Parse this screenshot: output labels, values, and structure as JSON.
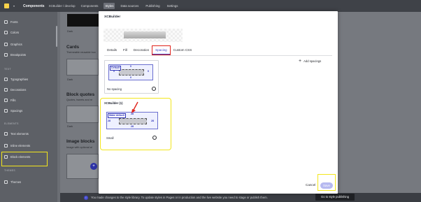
{
  "topbar": {
    "app_name": "Components",
    "app_sub": "XCBuilder / develop",
    "nav": [
      "Components",
      "Styles",
      "Data sources",
      "Publishing",
      "Settings"
    ],
    "active_nav": "Styles"
  },
  "sidebar": {
    "items_top": [
      "Fonts",
      "Colors",
      "Graphics",
      "Breakpoints"
    ],
    "section_text": "TEXT",
    "items_text": [
      "Typographies",
      "Decorations",
      "Fills",
      "Spacings"
    ],
    "section_elements": "ELEMENTS",
    "items_elements": [
      "Text elements",
      "Inline elements",
      "Block elements"
    ],
    "section_themes": "THEMES",
    "items_themes": [
      "Themes"
    ]
  },
  "background": {
    "dark_label_1": "Dark",
    "cards_title": "Cards",
    "cards_sub": "Themeable reusable box",
    "dark_label_2": "Dark",
    "quotes_title": "Block quotes",
    "quotes_sub": "Quotes, tweets and re",
    "dark_label_3": "Dark",
    "images_title": "Image blocks",
    "images_sub": "Image with optional al",
    "plus": "+"
  },
  "modal": {
    "title": "XCBuilder",
    "tabs": [
      "Details",
      "Fill",
      "Decoration",
      "Spacing",
      "Custom CSS"
    ],
    "active_tab": "Spacing",
    "add_spacing": "Add spacings",
    "card_a": {
      "tag": "Default",
      "numbers": [
        "0",
        "0",
        "0",
        "0"
      ],
      "label": "No spacing",
      "more": "..."
    },
    "card_b": {
      "header": "XCBuilder (1)",
      "tag": "Make default",
      "numbers": [
        "28",
        "28",
        "28",
        "28"
      ],
      "label": "Small",
      "more": "..."
    },
    "cancel": "Cancel",
    "save": "Save"
  },
  "footer": {
    "info_icon": "i",
    "message": "You made changes to the style library. To update styles in Pages or in production and the live website you need to stage or publish them.",
    "tooltip": "Go to style publishing"
  },
  "colors": {
    "accent": "#3a3fc4",
    "highlight_yellow": "#f3e61c",
    "highlight_red": "#e0221b",
    "save_disabled": "#b6b9f0"
  }
}
